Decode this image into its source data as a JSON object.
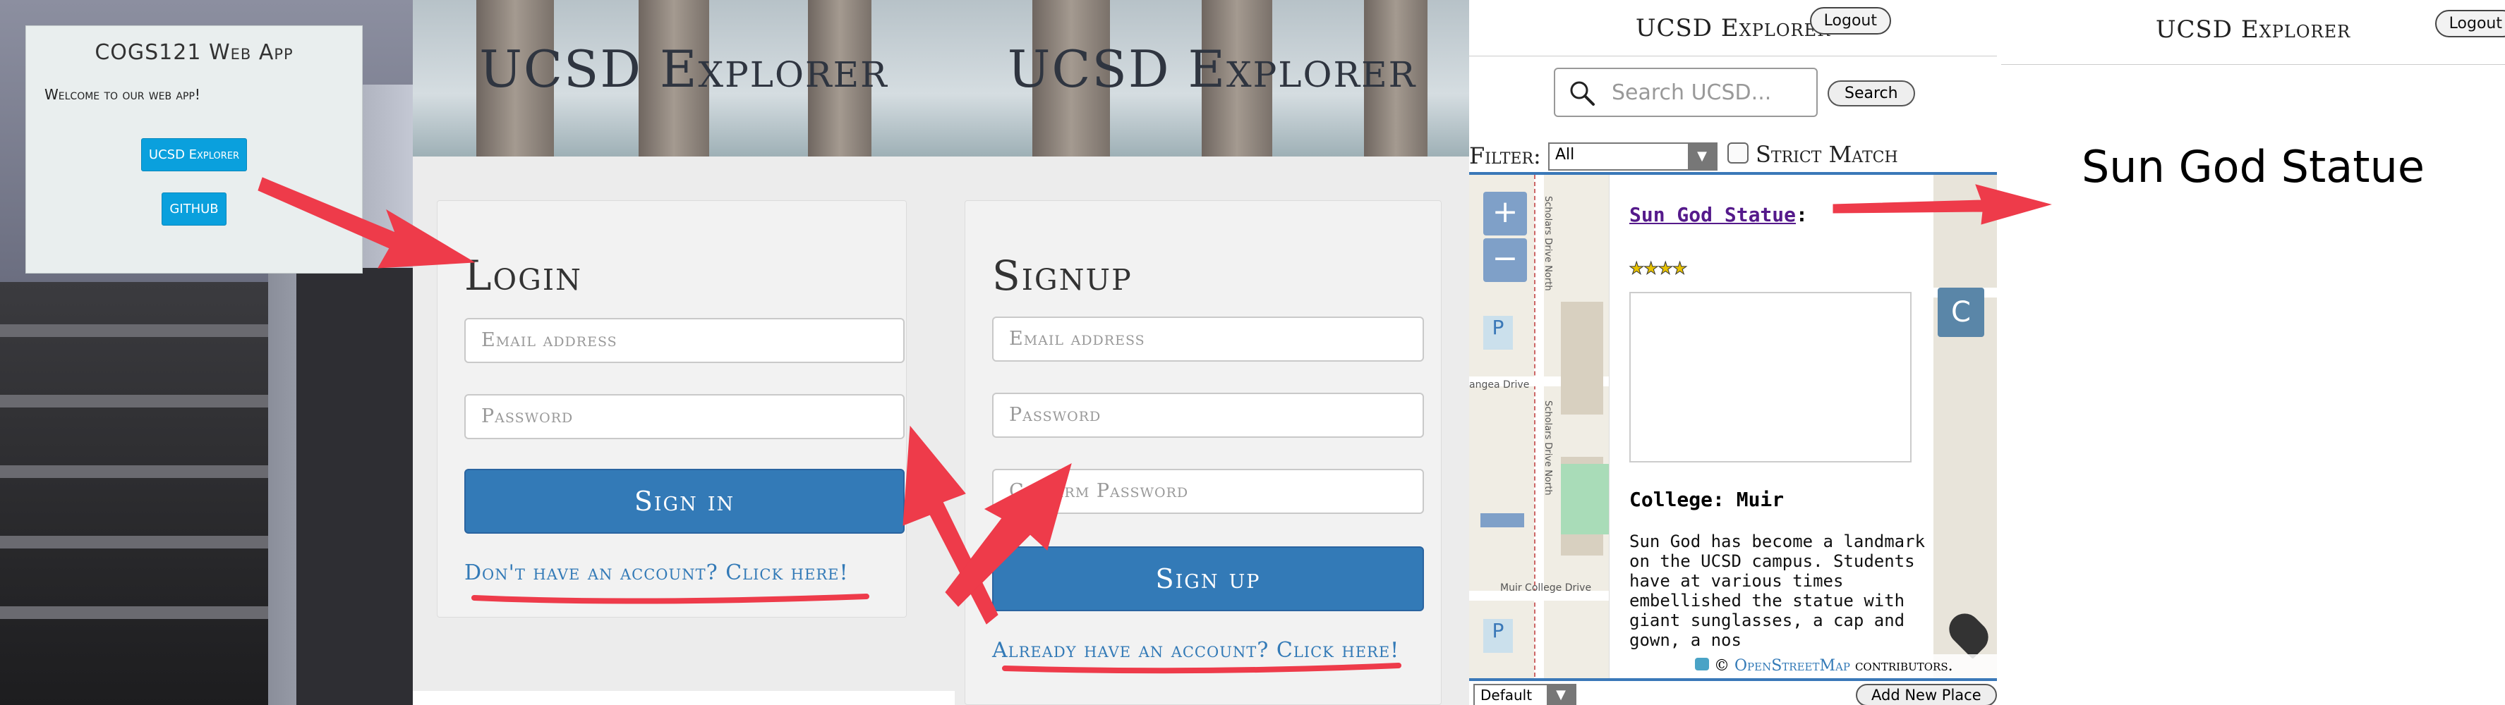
{
  "home": {
    "title": "COGS121 Web App",
    "welcome": "Welcome to our web app!",
    "explorer_button": "UCSD Explorer",
    "github_button": "GITHUB"
  },
  "login": {
    "hero_title": "UCSD Explorer",
    "heading": "Login",
    "email_placeholder": "Email address",
    "password_placeholder": "Password",
    "submit_label": "Sign in",
    "link_text": "Don't have an account? Click here!"
  },
  "signup": {
    "hero_title": "UCSD Explorer",
    "heading": "Signup",
    "email_placeholder": "Email address",
    "password_placeholder": "Password",
    "confirm_placeholder": "Confirm Password",
    "submit_label": "Sign up",
    "link_text": "Already have an account? Click here!"
  },
  "explorer": {
    "title": "UCSD Explorer",
    "logout_label": "Logout",
    "search_placeholder": "Search UCSD...",
    "search_button": "Search",
    "filter_label": "Filter:",
    "filter_value": "All",
    "strict_match_label": "Strict Match",
    "map_labels": [
      "Scholars Drive North",
      "Scholars Drive North",
      "angea Drive",
      "Muir College Drive"
    ],
    "map_tile_letter": "C",
    "zoom_in": "+",
    "zoom_out": "−",
    "popup": {
      "place_name": "Sun God Statue",
      "rating_stars": 4,
      "college": "College: Muir",
      "description": "Sun God has become a landmark on the UCSD campus. Students have at various times embellished the statue with giant sunglasses, a cap and gown, a nos"
    },
    "attribution_prefix": "©",
    "attribution_link": "OpenStreetMap",
    "attribution_suffix": "contributors.",
    "bottom_select": "Default",
    "add_place_button": "Add New Place"
  },
  "detail": {
    "title": "UCSD Explorer",
    "logout_label": "Logout",
    "place_name": "Sun God Statue"
  },
  "colors": {
    "primary_blue": "#337ab7",
    "arrow_red": "#ee3b4a",
    "link_purple": "#551a8b",
    "home_button": "#0aa0dd"
  }
}
